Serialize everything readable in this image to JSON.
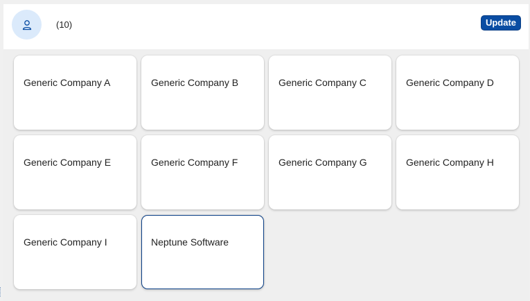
{
  "header": {
    "avatar_icon": "person-icon",
    "count": "(10)",
    "update_label": "Update"
  },
  "tiles": [
    "Generic Company A",
    "Generic Company B",
    "Generic Company C",
    "Generic Company D",
    "Generic Company E",
    "Generic Company F",
    "Generic Company G",
    "Generic Company H",
    "Generic Company I",
    "Neptune Software"
  ],
  "colors": {
    "accent": "#0a4da3",
    "avatar_bg": "#dbeafb",
    "background": "#efefef"
  }
}
